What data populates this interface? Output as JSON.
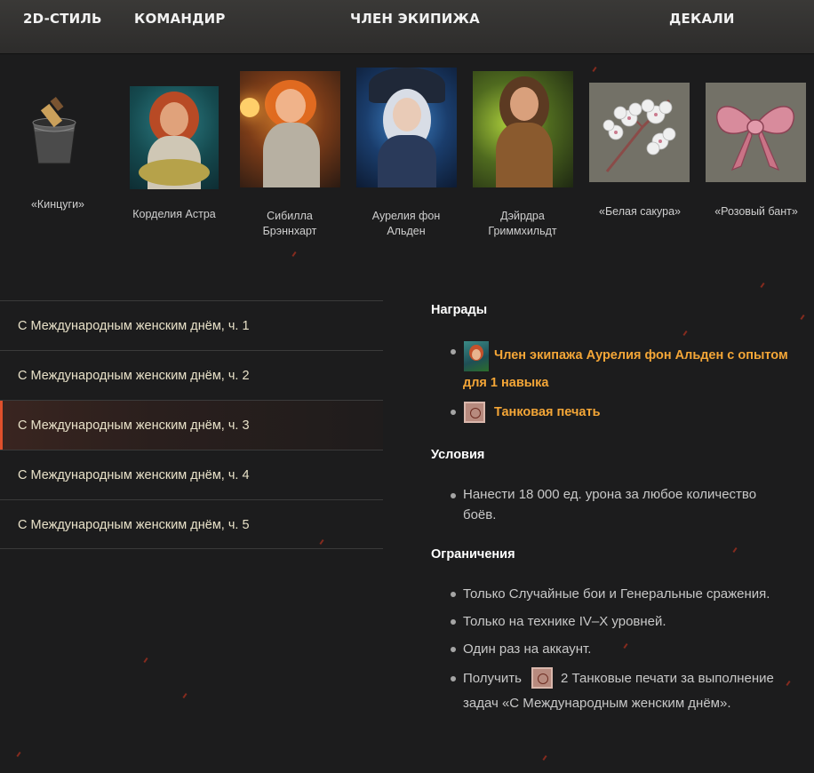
{
  "header": {
    "col_style": "2D-СТИЛЬ",
    "col_commander": "КОМАНДИР",
    "col_crew": "ЧЛЕН ЭКИПИЖА",
    "col_decals": "ДЕКАЛИ"
  },
  "items": {
    "style": "«Кинцуги»",
    "commander": "Корделия Астра",
    "crew_1": "Сибилла Брэннхарт",
    "crew_2": "Аурелия фон Альден",
    "crew_3": "Дэйрдра Гриммхильдт",
    "decal_1": "«Белая сакура»",
    "decal_2": "«Розовый бант»"
  },
  "missions": [
    {
      "label": "С Международным женским днём, ч. 1"
    },
    {
      "label": "С Международным женским днём, ч. 2"
    },
    {
      "label": "С Международным женским днём, ч. 3"
    },
    {
      "label": "С Международным женским днём, ч. 4"
    },
    {
      "label": "С Международным женским днём, ч. 5"
    }
  ],
  "active_mission_index": 2,
  "details": {
    "rewards_title": "Награды",
    "reward_1_line1": "Член экипажа Аурелия фон Альден с опытом",
    "reward_1_line2": "для 1 навыка",
    "reward_2": "Танковая печать",
    "conditions_title": "Условия",
    "condition_1_line1": "Нанести 18 000 ед. урона за любое количество",
    "condition_1_line2": "боёв.",
    "restrictions_title": "Ограничения",
    "restriction_1": "Только Случайные бои и Генеральные сражения.",
    "restriction_2": "Только на технике IV–X уровней.",
    "restriction_3": "Один раз на аккаунт.",
    "restriction_4_prefix": "Получить",
    "restriction_4_line1": "2 Танковые печати за выполнение",
    "restriction_4_line2": "задач «С Международным женским днём»."
  },
  "colors": {
    "accent_orange": "#f4a637",
    "active_marker": "#e0502c",
    "background": "#1c1c1d"
  }
}
